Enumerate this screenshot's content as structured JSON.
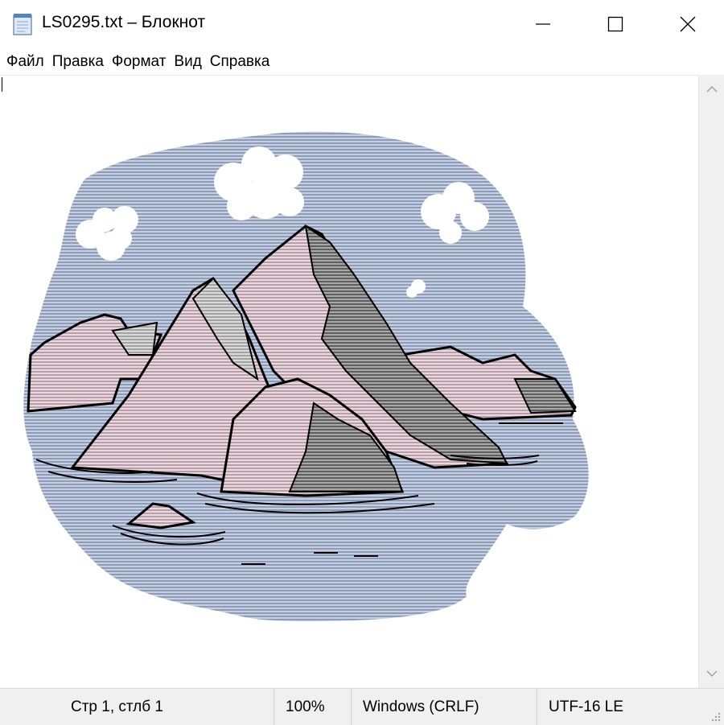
{
  "window": {
    "title": "LS0295.txt – Блокнот",
    "app_icon": "notepad-icon",
    "controls": [
      "minimize-icon",
      "maximize-icon",
      "close-icon"
    ]
  },
  "menu": {
    "file": "Файл",
    "edit": "Правка",
    "format": "Формат",
    "view": "Вид",
    "help": "Справка"
  },
  "editor": {
    "content": "ASCII-art clipart of mountains rising from water under a cloudy sky, rendered in colored line characters",
    "colors": {
      "sky": "#b3c0d6",
      "mountain_light": "#d9c4cc",
      "mountain_dark": "#8a8a8a",
      "outline": "#000000"
    }
  },
  "status": {
    "position": "Стр 1, стлб 1",
    "zoom": "100%",
    "line_endings": "Windows (CRLF)",
    "encoding": "UTF-16 LE"
  }
}
